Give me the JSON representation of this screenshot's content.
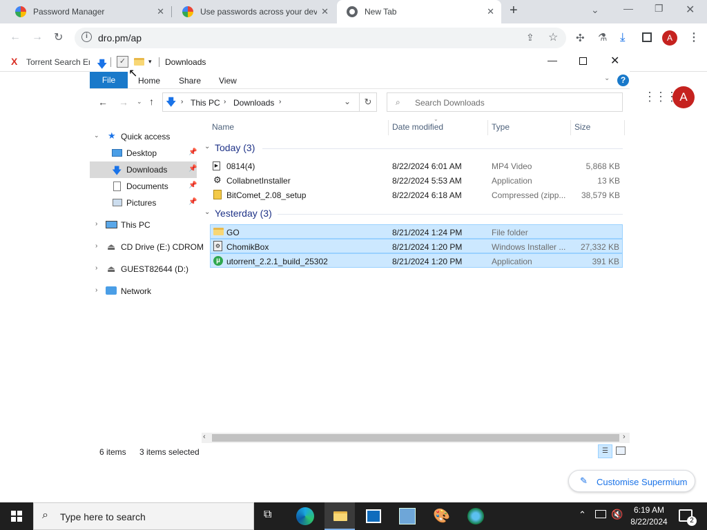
{
  "browser": {
    "tabs": [
      {
        "title": "Password Manager"
      },
      {
        "title": "Use passwords across your devi"
      },
      {
        "title": "New Tab"
      }
    ],
    "new_tab_label": "+",
    "address": "dro.pm/ap",
    "profile_initial": "A",
    "bookmarks": [
      {
        "label": "Torrent Search En"
      }
    ],
    "customise_label": "Customise Supermium",
    "apps_profile_initial": "A"
  },
  "explorer": {
    "title": "Downloads",
    "ribbon_tabs": [
      "File",
      "Home",
      "Share",
      "View"
    ],
    "breadcrumb": [
      "This PC",
      "Downloads"
    ],
    "search_placeholder": "Search Downloads",
    "columns": {
      "name": "Name",
      "date": "Date modified",
      "type": "Type",
      "size": "Size"
    },
    "groups": [
      {
        "label": "Today (3)",
        "files": [
          {
            "name": "0814(4)",
            "date": "8/22/2024 6:01 AM",
            "type": "MP4 Video",
            "size": "5,868 KB"
          },
          {
            "name": "CollabnetInstaller",
            "date": "8/22/2024 5:53 AM",
            "type": "Application",
            "size": "13 KB"
          },
          {
            "name": "BitComet_2.08_setup",
            "date": "8/22/2024 6:18 AM",
            "type": "Compressed (zipp...",
            "size": "38,579 KB"
          }
        ]
      },
      {
        "label": "Yesterday (3)",
        "files": [
          {
            "name": "GO",
            "date": "8/21/2024 1:24 PM",
            "type": "File folder",
            "size": ""
          },
          {
            "name": "ChomikBox",
            "date": "8/21/2024 1:20 PM",
            "type": "Windows Installer ...",
            "size": "27,332 KB"
          },
          {
            "name": "utorrent_2.2.1_build_25302",
            "date": "8/21/2024 1:20 PM",
            "type": "Application",
            "size": "391 KB"
          }
        ]
      }
    ],
    "nav": {
      "quick_access": "Quick access",
      "quick_items": [
        "Desktop",
        "Downloads",
        "Documents",
        "Pictures"
      ],
      "roots": [
        "This PC",
        "CD Drive (E:) CDROM",
        "GUEST82644 (D:)",
        "Network"
      ]
    },
    "status": {
      "items": "6 items",
      "selected": "3 items selected"
    }
  },
  "taskbar": {
    "search_placeholder": "Type here to search",
    "time": "6:19 AM",
    "date": "8/22/2024",
    "notification_count": "2"
  }
}
